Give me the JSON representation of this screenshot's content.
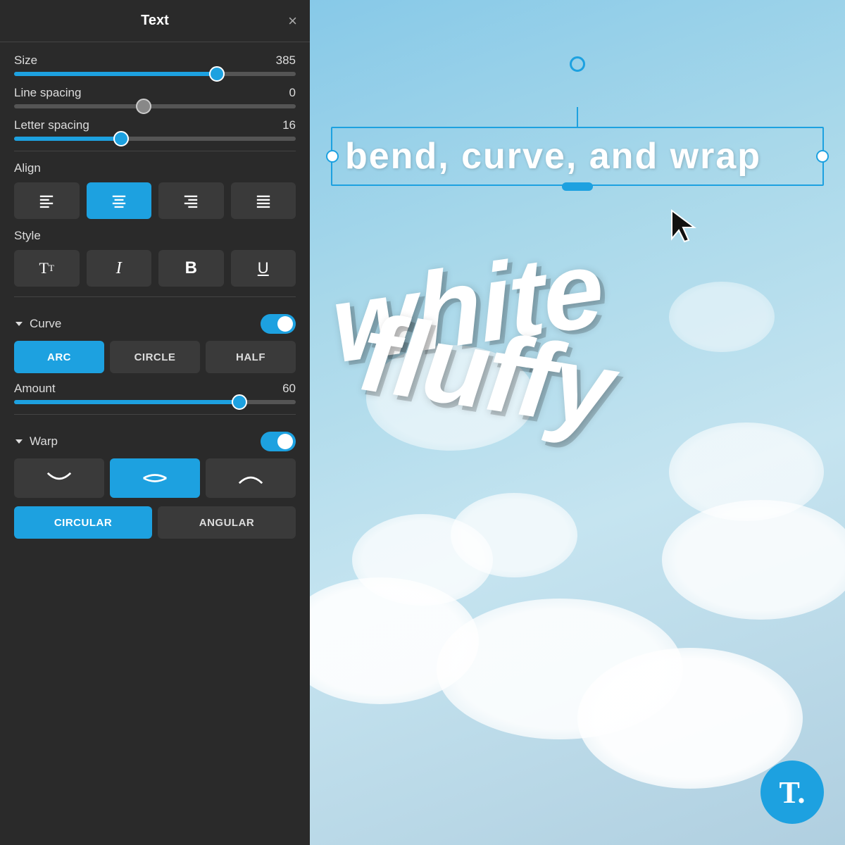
{
  "panel": {
    "title": "Text",
    "close_label": "×",
    "size": {
      "label": "Size",
      "value": "385",
      "thumb_percent": 72
    },
    "line_spacing": {
      "label": "Line spacing",
      "value": "0",
      "thumb_percent": 46
    },
    "letter_spacing": {
      "label": "Letter spacing",
      "value": "16",
      "thumb_percent": 38
    },
    "align": {
      "label": "Align",
      "buttons": [
        "left",
        "center",
        "right",
        "justify"
      ],
      "active": 1
    },
    "style": {
      "label": "Style",
      "buttons": [
        "Tt",
        "I",
        "B",
        "U"
      ]
    },
    "curve": {
      "label": "Curve",
      "enabled": true,
      "types": [
        "ARC",
        "CIRCLE",
        "HALF"
      ],
      "active_type": 0,
      "amount_label": "Amount",
      "amount_value": "60",
      "amount_thumb_percent": 80
    },
    "warp": {
      "label": "Warp",
      "enabled": true,
      "shapes": [
        "down-arch",
        "up-arch",
        "flat-arch"
      ],
      "active_shape": 1,
      "types": [
        "CIRCULAR",
        "ANGULAR"
      ],
      "active_type": 0
    }
  },
  "canvas": {
    "text_box_content": "bend, curve, and wrap",
    "main_text_line1": "white",
    "main_text_line2": "fluffy"
  }
}
